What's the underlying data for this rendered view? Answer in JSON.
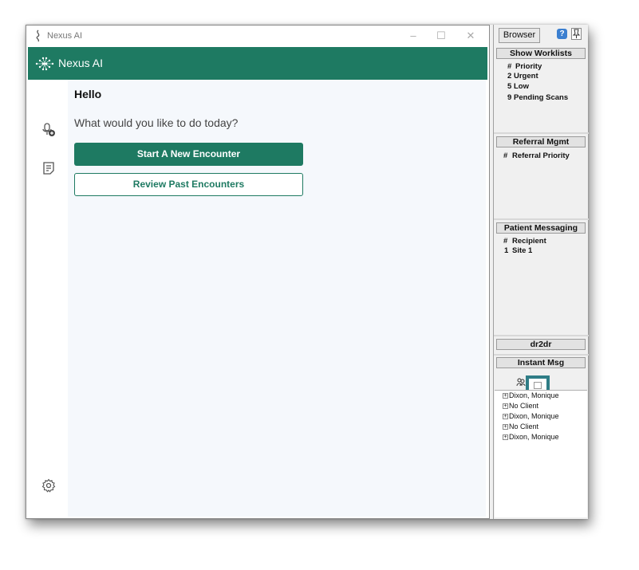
{
  "app": {
    "window_title": "Nexus AI",
    "brand_name": "Nexus AI",
    "brand_color": "#1e7a62",
    "window_controls": [
      "–",
      "☐",
      "✕"
    ],
    "greeting": "Hello",
    "prompt": "What would you like to do today?",
    "primary_button": "Start A New Encounter",
    "secondary_button": "Review Past Encounters",
    "rail_icons": [
      "microphone-add-icon",
      "notes-icon",
      "settings-gear-icon"
    ]
  },
  "panel": {
    "browser_label": "Browser",
    "help_label": "?",
    "sections": {
      "worklists": {
        "title": "Show Worklists",
        "header_hash": "#",
        "header_label": "Priority",
        "rows": [
          {
            "count": "2",
            "label": "Urgent"
          },
          {
            "count": "5",
            "label": "Low"
          },
          {
            "count": "9",
            "label": "Pending Scans"
          }
        ]
      },
      "referral": {
        "title": "Referral Mgmt",
        "header_hash": "#",
        "header_label": "Referral Priority"
      },
      "messaging": {
        "title": "Patient Messaging",
        "header_hash": "#",
        "header_label": "Recipient",
        "rows": [
          {
            "count": "1",
            "label": "Site 1"
          }
        ]
      },
      "dr2dr": {
        "title": "dr2dr"
      },
      "instant_msg": {
        "title": "Instant Msg",
        "items": [
          "Dixon, Monique",
          "No Client",
          "Dixon, Monique",
          "No Client",
          "Dixon, Monique"
        ]
      }
    },
    "highlight_color": "#2f7d86"
  }
}
